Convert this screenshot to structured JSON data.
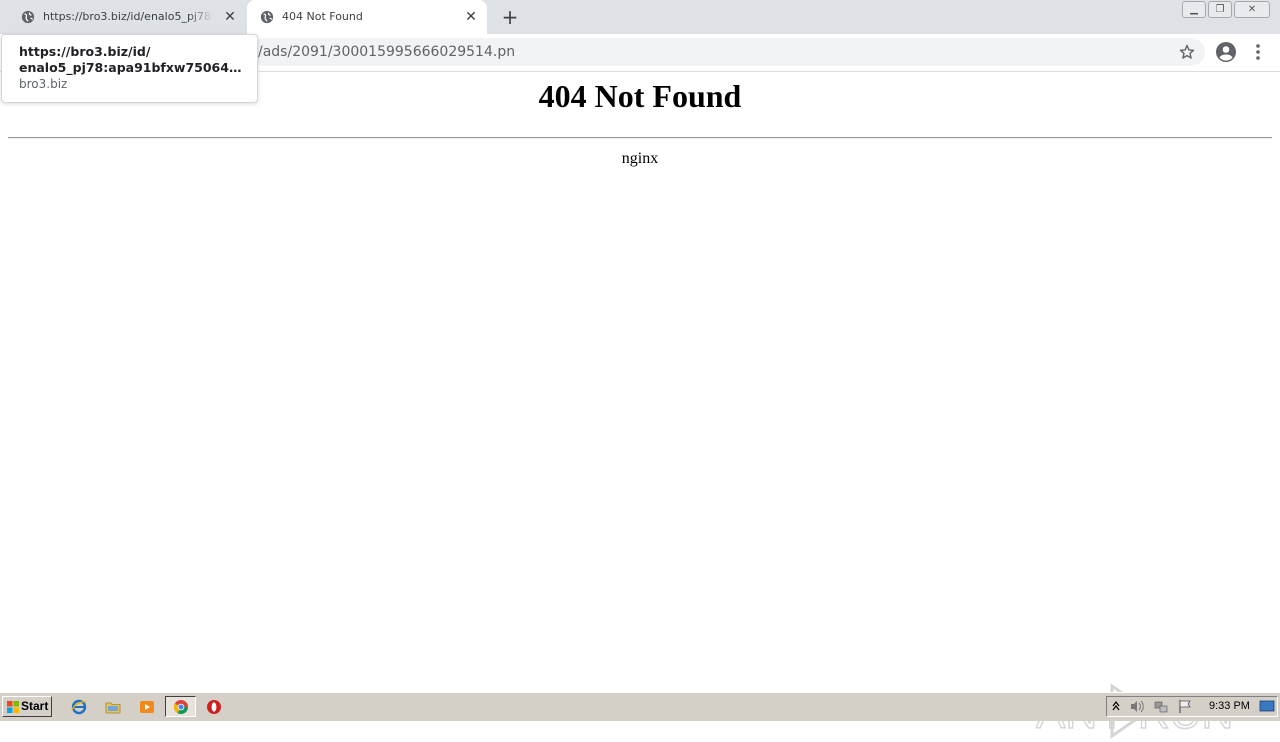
{
  "browser": {
    "tabs": [
      {
        "title": "https://bro3.biz/id/enalo5_pj78:apa91bfxw750640g",
        "active": false
      },
      {
        "title": "404 Not Found",
        "active": true
      }
    ],
    "new_tab": "+",
    "address_bar": {
      "url": "/ads/2091/300015995666029514.pn"
    },
    "hover_card": {
      "title_line1": "https://bro3.biz/id/",
      "title_line2": "enalo5_pj78:apa91bfxw750640g...",
      "domain": "bro3.biz"
    }
  },
  "page": {
    "heading": "404 Not Found",
    "server": "nginx"
  },
  "watermark": {
    "text": "ANY RUN"
  },
  "taskbar": {
    "start_label": "Start",
    "quick_launch": [
      "internet-explorer-icon",
      "folder-icon",
      "media-player-icon",
      "chrome-icon",
      "opera-icon"
    ],
    "clock": "9:33 PM"
  },
  "colors": {
    "tabstrip": "#dee1e6",
    "omnibox": "#f1f3f4",
    "taskbar": "#d4d0c8"
  }
}
